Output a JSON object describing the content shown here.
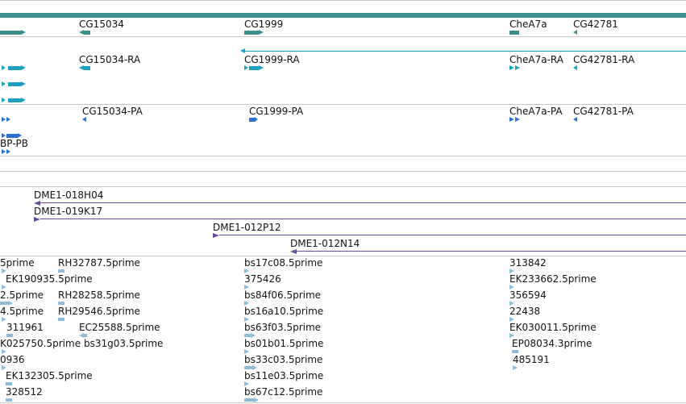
{
  "gene_track": {
    "labels": [
      "CG15034",
      "CG1999",
      "CheA7a",
      "CG42781"
    ],
    "color": "#3f8f8f"
  },
  "transcript_track": {
    "labels": [
      "CG15034-RA",
      "CG1999-RA",
      "CheA7a-RA",
      "CG42781-RA"
    ],
    "color": "#1aa0c0"
  },
  "protein_track": {
    "labels": [
      "CG15034-PA",
      "CG1999-PA",
      "CheA7a-PA",
      "CG42781-PA",
      "BP-PB"
    ],
    "color": "#2f6fcf"
  },
  "clone_track": {
    "labels": [
      "DME1-018H04",
      "DME1-019K17",
      "DME1-012P12",
      "DME1-012N14"
    ],
    "color": "#6a4a9a"
  },
  "est_track": {
    "color": "#8cbcdc",
    "col1": [
      "5prime",
      "EK190935.5prime",
      "2.5prime",
      "4.5prime",
      "311961",
      "K025750.5prime",
      "0936",
      "EK132305.5prime",
      "328512"
    ],
    "col2": [
      "RH32787.5prime",
      "RH28258.5prime",
      "RH29546.5prime",
      "EC25588.5prime",
      "bs31g03.5prime"
    ],
    "col3": [
      "bs17c08.5prime",
      "375426",
      "bs84f06.5prime",
      "bs16a10.5prime",
      "bs63f03.5prime",
      "bs01b01.5prime",
      "bs33c03.5prime",
      "bs11e03.5prime",
      "bs67c12.5prime"
    ],
    "col4": [
      "313842",
      "EK233662.5prime",
      "356594",
      "22438",
      "EK030011.5prime",
      "EP08034.3prime",
      "485191"
    ]
  }
}
